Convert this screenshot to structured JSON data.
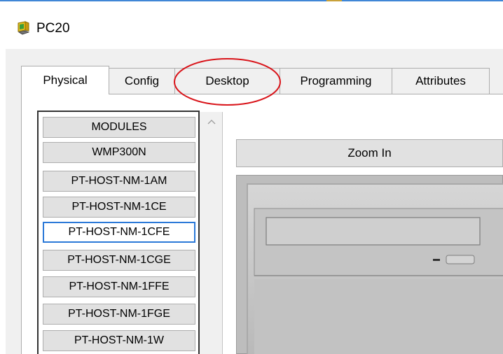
{
  "window": {
    "title": "PC20",
    "icon": "pc-computer-icon"
  },
  "tabs": [
    {
      "label": "Physical",
      "active": true
    },
    {
      "label": "Config",
      "active": false
    },
    {
      "label": "Desktop",
      "active": false,
      "highlighted": true
    },
    {
      "label": "Programming",
      "active": false
    },
    {
      "label": "Attributes",
      "active": false
    }
  ],
  "modules": {
    "items": [
      "MODULES",
      "WMP300N",
      "PT-HOST-NM-1AM",
      "PT-HOST-NM-1CE",
      "PT-HOST-NM-1CFE",
      "PT-HOST-NM-1CGE",
      "PT-HOST-NM-1FFE",
      "PT-HOST-NM-1FGE",
      "PT-HOST-NM-1W"
    ],
    "selected": "PT-HOST-NM-1CFE"
  },
  "device_view": {
    "zoom_label": "Zoom In"
  },
  "colors": {
    "highlight_circle": "#d9151b",
    "selected_border": "#2b79d8",
    "tab_border": "#adadad"
  }
}
